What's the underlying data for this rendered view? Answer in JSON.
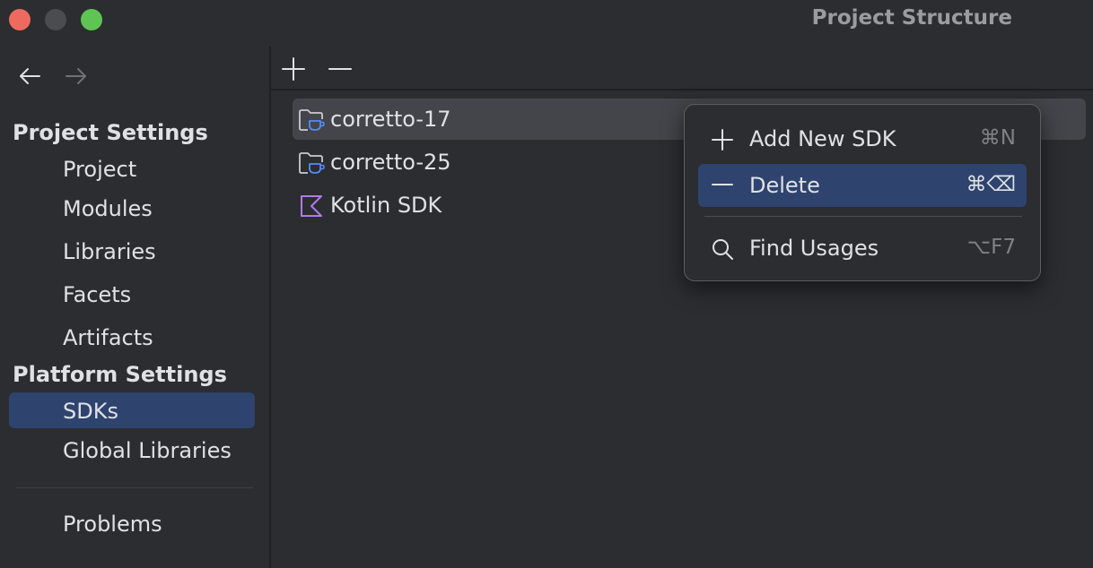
{
  "window": {
    "title": "Project Structure"
  },
  "sidebar": {
    "project_settings_header": "Project Settings",
    "project_items": [
      {
        "label": "Project"
      },
      {
        "label": "Modules"
      },
      {
        "label": "Libraries"
      },
      {
        "label": "Facets"
      },
      {
        "label": "Artifacts"
      }
    ],
    "platform_settings_header": "Platform Settings",
    "platform_items": [
      {
        "label": "SDKs",
        "selected": true
      },
      {
        "label": "Global Libraries"
      }
    ],
    "problems_label": "Problems"
  },
  "sdk_list": [
    {
      "label": "corretto-17",
      "icon": "jdk-folder-icon",
      "selected": true
    },
    {
      "label": "corretto-25",
      "icon": "jdk-folder-icon"
    },
    {
      "label": "Kotlin SDK",
      "icon": "kotlin-icon"
    }
  ],
  "context_menu": {
    "items": [
      {
        "label": "Add New SDK",
        "shortcut": "⌘N",
        "icon": "plus-icon"
      },
      {
        "label": "Delete",
        "shortcut": "⌘⌫",
        "icon": "minus-icon",
        "highlighted": true
      },
      {
        "label": "Find Usages",
        "shortcut": "⌥F7",
        "icon": "search-icon"
      }
    ]
  },
  "colors": {
    "background": "#2b2d30",
    "selection": "#2e436e",
    "tree_selection": "#43454a",
    "text": "#dfe1e5",
    "muted_text": "#7e8185",
    "jdk_icon_accent": "#548af7",
    "kotlin_icon": "#b07be8",
    "close": "#ee6a5f",
    "maximize": "#5fc454"
  }
}
